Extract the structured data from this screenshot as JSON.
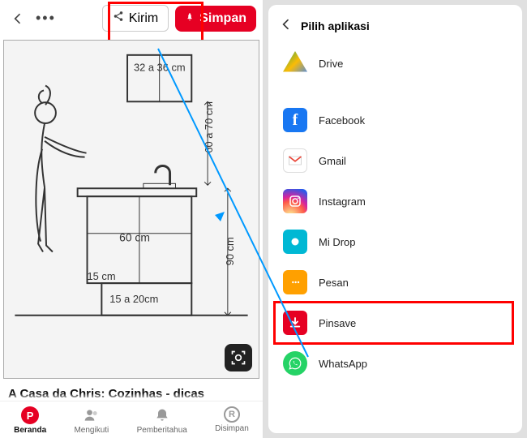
{
  "left": {
    "toolbar": {
      "share_label": "Kirim",
      "save_label": "Simpan"
    },
    "dimensions": {
      "cabinet_width": "32 a 36 cm",
      "upper_gap": "60 a 70 cm",
      "counter_width": "60 cm",
      "toe_kick_depth": "15 cm",
      "toe_kick_height": "15 a 20cm",
      "counter_height": "90 cm"
    },
    "pin_title": "A Casa da Chris: Cozinhas - dicas",
    "nav": {
      "home": "Beranda",
      "following": "Mengikuti",
      "notifications": "Pemberitahua",
      "saved": "Disimpan"
    }
  },
  "right": {
    "sheet_title": "Pilih aplikasi",
    "apps": {
      "drive": "Drive",
      "facebook": "Facebook",
      "gmail": "Gmail",
      "instagram": "Instagram",
      "midrop": "Mi Drop",
      "pesan": "Pesan",
      "pinsave": "Pinsave",
      "whatsapp": "WhatsApp"
    }
  },
  "colors": {
    "accent": "#e60023"
  }
}
